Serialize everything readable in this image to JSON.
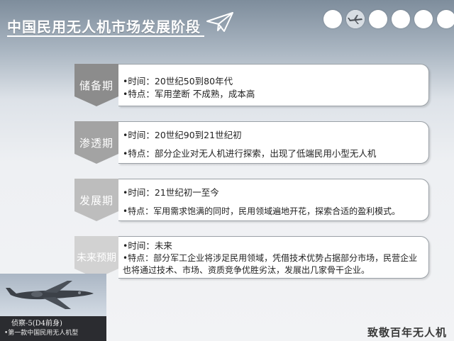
{
  "header": {
    "title": "中国民用无人机市场发展阶段"
  },
  "stages": [
    {
      "label": "储备期",
      "color": "#8c8c8c",
      "lines": [
        "•时间：20世纪50到80年代",
        "•特点：军用垄断 不成熟，成本高"
      ]
    },
    {
      "label": "渗透期",
      "color": "#a3a3a3",
      "lines": [
        "•时间：20世纪90到21世纪初",
        "•特点：部分企业对无人机进行探索，出现了低端民用小型无人机"
      ]
    },
    {
      "label": "发展期",
      "color": "#bdbdbd",
      "lines": [
        "•时间：21世纪初一至今",
        "•特点：军用需求饱满的同时，民用领域遍地开花，探索合适的盈利模式。"
      ]
    },
    {
      "label": "未来预期",
      "color": "#d2d2d2",
      "lines": [
        "•时间：未来",
        "•特点：部分军工企业将涉足民用领域，凭借技术优势占据部分市场，民营企业也将通过技术、市场、资质竞争优胜劣汰，发展出几家骨干企业。"
      ]
    }
  ],
  "photo": {
    "caption_title": "侦察-5(D4前身)",
    "caption_sub": "•第一款中国民用无人机型"
  },
  "footer": {
    "text": "致敬百年无人机"
  },
  "colors": {
    "title_text": "#ffffff",
    "box_border": "#9aa0a6"
  },
  "icons": [
    "paper-plane-icon",
    "drone-thumbnail-icon"
  ]
}
